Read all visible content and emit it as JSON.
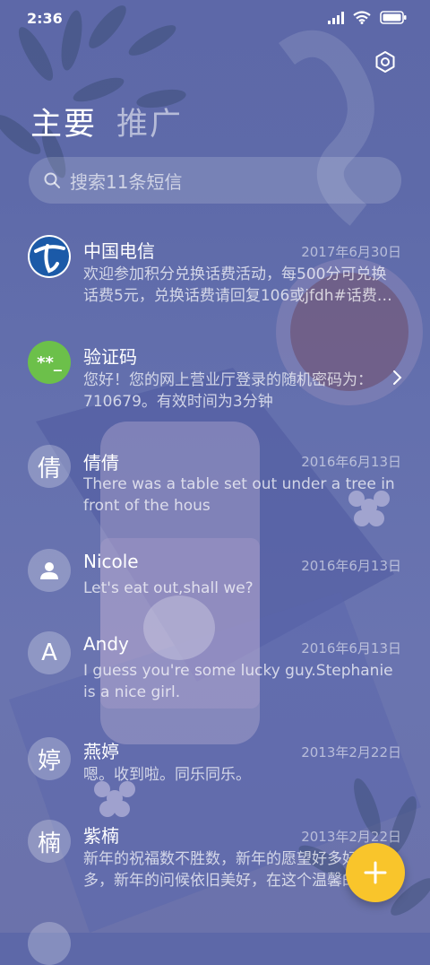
{
  "status_bar": {
    "time": "2:36"
  },
  "tabs": [
    {
      "label": "主要",
      "active": true
    },
    {
      "label": "推广",
      "active": false
    }
  ],
  "search": {
    "placeholder": "搜索11条短信"
  },
  "conversations": [
    {
      "name": "中国电信",
      "date": "2017年6月30日",
      "avatar_type": "telecom-logo",
      "preview": "欢迎参加积分兑换话费活动，每500分可兑换话费5元，兑换话费请回复106或jfdh#话费…"
    },
    {
      "name": "验证码",
      "date": "",
      "avatar_type": "verification-badge",
      "avatar_text": "**_",
      "preview": "您好！您的网上营业厅登录的随机密码为：710679。有效时间为3分钟"
    },
    {
      "name": "倩倩",
      "date": "2016年6月13日",
      "avatar_text": "倩",
      "preview": "There was a table set out under a tree in front of the hous"
    },
    {
      "name": "Nicole",
      "date": "2016年6月13日",
      "avatar_type": "person-icon",
      "preview": "Let's eat out,shall we?"
    },
    {
      "name": "Andy",
      "date": "2016年6月13日",
      "avatar_text": "A",
      "preview": "I guess you're some lucky guy.Stephanie is a nice girl."
    },
    {
      "name": "燕婷",
      "date": "2013年2月22日",
      "avatar_text": "婷",
      "preview": "嗯。收到啦。同乐同乐。"
    },
    {
      "name": "紫楠",
      "date": "2013年2月22日",
      "avatar_text": "楠",
      "preview": "新年的祝福数不胜数，新年的愿望好多好多，新年的问候依旧美好，在这个温馨的时刻"
    }
  ],
  "colors": {
    "fab": "#f9c52b",
    "verification_badge": "#6cc04a",
    "telecom_blue": "#1b5aa8"
  }
}
